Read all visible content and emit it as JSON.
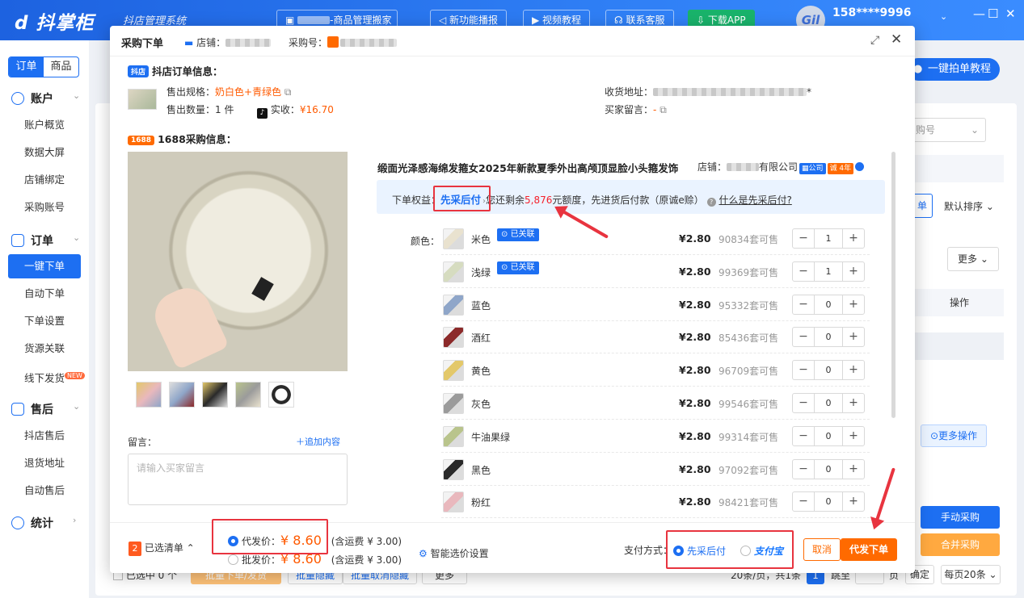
{
  "app": {
    "logo": "抖掌柜",
    "subtitle": "抖店管理系统",
    "nav_buttons": [
      "-商品管理搬家",
      "新功能播报",
      "视频教程",
      "联系客服",
      "下载APP"
    ],
    "user_phone": "158****9996",
    "avatar_text": "Gil",
    "minimize": "—",
    "maximize": "☐",
    "close": "✕"
  },
  "sidebar": {
    "tabs": [
      "订单",
      "商品"
    ],
    "groups": [
      {
        "label": "账户",
        "items": [
          "账户概览",
          "数据大屏",
          "店铺绑定",
          "采购账号"
        ]
      },
      {
        "label": "订单",
        "items": [
          "一键下单",
          "自动下单",
          "下单设置",
          "货源关联",
          "线下发货"
        ]
      },
      {
        "label": "售后",
        "items": [
          "抖店售后",
          "退货地址",
          "自动售后"
        ]
      },
      {
        "label": "统计",
        "items": []
      }
    ],
    "new_tag": "NEW",
    "active_item": "一键下单"
  },
  "background": {
    "tutorial_button": "一键拍单教程",
    "sort": "默认排序",
    "more": "更多",
    "operation": "操作",
    "more_ops": "更多操作",
    "manual_purchase": "手动采购",
    "merge_purchase": "合并采购",
    "select_placeholder": "购号",
    "order_tag": "单",
    "confirm": "确定",
    "per_page": "每页20条",
    "pagination_text": "20条/页，共1条",
    "page_number": "1",
    "goto": "跳至",
    "page_suffix": "页",
    "selected_count": "已选中 0 个",
    "batch_buttons": [
      "批量下单/发货",
      "批量隐藏",
      "批量取消隐藏",
      "更多"
    ]
  },
  "modal": {
    "title": "采购下单",
    "shop_label": "店铺：",
    "purchase_no_label": "采购号：",
    "douyin_section": {
      "badge": "抖店",
      "title": "抖店订单信息：",
      "spec_label": "售出规格：",
      "spec_value": "奶白色+青绿色",
      "qty_label": "售出数量：",
      "qty_value": "1 件",
      "paid_label": "实收：",
      "paid_value": "¥16.70",
      "address_label": "收货地址：",
      "address_suffix": "*",
      "buyer_msg_label": "买家留言：",
      "buyer_msg_value": "-"
    },
    "section_1688": {
      "badge": "1688",
      "title": "1688采购信息：",
      "product_title": "缎面光泽感海绵发箍女2025年新款夏季外出高颅顶显脸小头箍发饰",
      "shop_label": "店铺：",
      "shop_suffix": "有限公司",
      "tag_company": "公司",
      "tag_years": "诚 4年",
      "rights_label": "下单权益：",
      "rights_name": "先采后付",
      "rights_text_before": "您还剩余",
      "rights_amount": "5,876",
      "rights_text_after": "元额度，先进货后付款（原诚e赊）",
      "rights_help": "什么是先采后付?",
      "color_label": "颜色：",
      "linked_text": "已关联",
      "colors": [
        {
          "name": "米色",
          "linked": true,
          "price": "¥2.80",
          "stock": "90834套可售",
          "qty": "1",
          "color": "#e9e2cf"
        },
        {
          "name": "浅绿",
          "linked": true,
          "price": "¥2.80",
          "stock": "99369套可售",
          "qty": "1",
          "color": "#d6dcc0"
        },
        {
          "name": "蓝色",
          "linked": false,
          "price": "¥2.80",
          "stock": "95332套可售",
          "qty": "0",
          "color": "#8fa6c9"
        },
        {
          "name": "酒红",
          "linked": false,
          "price": "¥2.80",
          "stock": "85436套可售",
          "qty": "0",
          "color": "#8c2a2a"
        },
        {
          "name": "黄色",
          "linked": false,
          "price": "¥2.80",
          "stock": "96709套可售",
          "qty": "0",
          "color": "#e3c86a"
        },
        {
          "name": "灰色",
          "linked": false,
          "price": "¥2.80",
          "stock": "99546套可售",
          "qty": "0",
          "color": "#9b9b9b"
        },
        {
          "name": "牛油果绿",
          "linked": false,
          "price": "¥2.80",
          "stock": "99314套可售",
          "qty": "0",
          "color": "#b9c48c"
        },
        {
          "name": "黑色",
          "linked": false,
          "price": "¥2.80",
          "stock": "97092套可售",
          "qty": "0",
          "color": "#2a2a2a"
        },
        {
          "name": "粉红",
          "linked": false,
          "price": "¥2.80",
          "stock": "98421套可售",
          "qty": "0",
          "color": "#e9b8bd"
        }
      ]
    },
    "message_label": "留言：",
    "add_content": "追加内容",
    "message_placeholder": "请输入买家留言",
    "footer": {
      "selected_count": "2",
      "selected_label": "已选清单",
      "dropship_label": "代发价：",
      "dropship_price": "¥ 8.60",
      "dropship_shipping": "(含运费 ¥ 3.00)",
      "wholesale_label": "批发价：",
      "wholesale_price": "¥ 8.60",
      "wholesale_shipping": "(含运费 ¥ 3.00)",
      "smart_setting": "智能选价设置",
      "pay_label": "支付方式：",
      "pay_option1": "先采后付",
      "pay_option2": "支付宝",
      "cancel": "取消",
      "submit": "代发下单"
    }
  },
  "colors": {
    "brand": "#1d6ff2",
    "highlight": "#e8343f",
    "orange": "#ff5a00"
  }
}
